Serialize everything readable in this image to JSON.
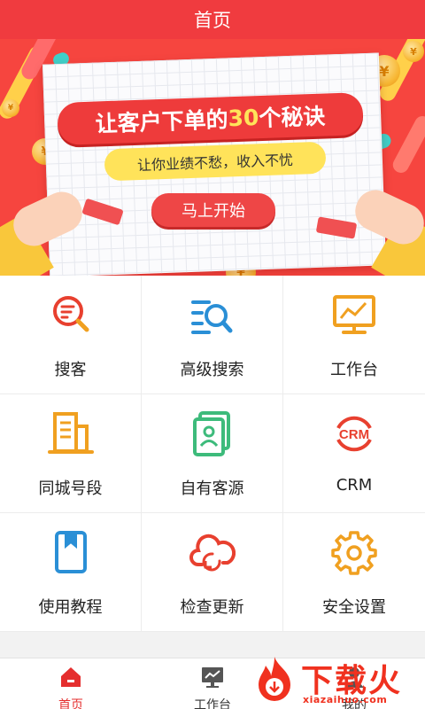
{
  "header": {
    "title": "首页"
  },
  "banner": {
    "headline_pre": "让客户下单的",
    "headline_num": "30",
    "headline_post": "个秘诀",
    "subline": "让你业绩不愁，收入不忧",
    "button": "马上开始"
  },
  "grid": {
    "items": [
      {
        "label": "搜客",
        "icon": "search-customer-icon"
      },
      {
        "label": "高级搜索",
        "icon": "advanced-search-icon"
      },
      {
        "label": "工作台",
        "icon": "workbench-monitor-icon"
      },
      {
        "label": "同城号段",
        "icon": "building-icon"
      },
      {
        "label": "自有客源",
        "icon": "contact-card-icon"
      },
      {
        "label": "CRM",
        "icon": "crm-icon"
      },
      {
        "label": "使用教程",
        "icon": "book-icon"
      },
      {
        "label": "检查更新",
        "icon": "cloud-refresh-icon"
      },
      {
        "label": "安全设置",
        "icon": "gear-icon"
      }
    ]
  },
  "tabbar": {
    "items": [
      {
        "label": "首页",
        "icon": "home-icon",
        "active": true
      },
      {
        "label": "工作台",
        "icon": "monitor-icon",
        "active": false
      },
      {
        "label": "我的",
        "icon": "user-icon",
        "active": false
      }
    ]
  },
  "watermark": {
    "text": "下载火",
    "url": "xiazaihuo.com"
  },
  "colors": {
    "primary": "#f03b3f",
    "accent_yellow": "#f7b733",
    "accent_blue": "#2a8fd6",
    "accent_green": "#3dbb7b"
  }
}
